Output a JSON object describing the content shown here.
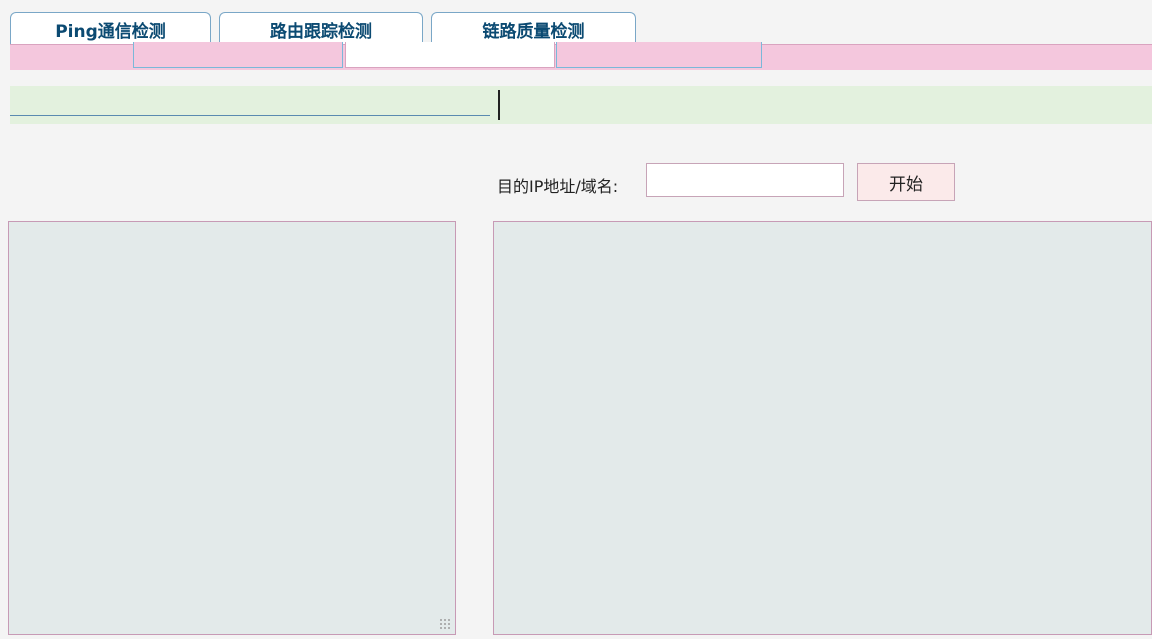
{
  "tabs": [
    {
      "label": "Ping通信检测"
    },
    {
      "label": "路由跟踪检测"
    },
    {
      "label": "链路质量检测"
    }
  ],
  "form": {
    "target_label": "目的IP地址/域名:",
    "target_value": "",
    "start_label": "开始"
  },
  "colors": {
    "tab_text": "#0b4a72",
    "tab_border": "#7aa7c7",
    "pink_band": "#f4c7dd",
    "green_band": "#e3f1de",
    "panel_bg": "#e3eaea",
    "panel_border": "#c79ab5",
    "button_bg": "#fbeaea"
  }
}
